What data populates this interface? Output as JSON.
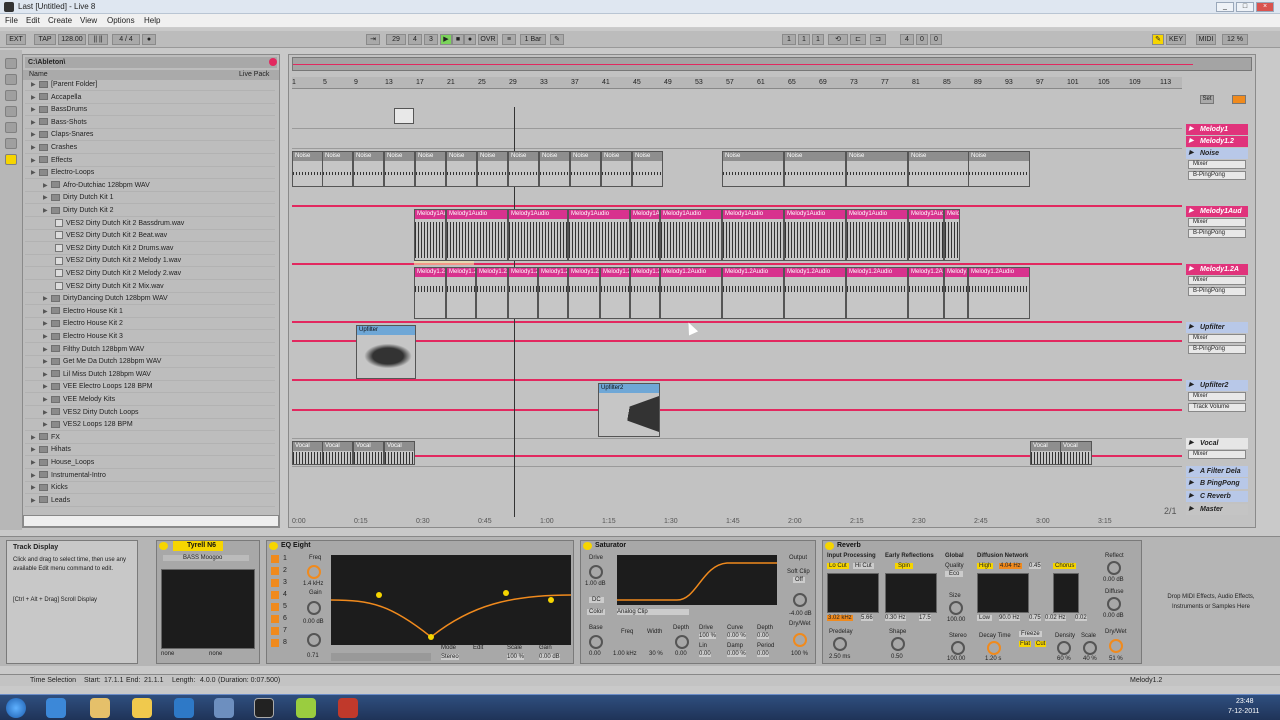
{
  "window": {
    "title": "Last  [Untitled] - Live 8",
    "controls": [
      "_",
      "□",
      "×"
    ]
  },
  "menu": [
    "File",
    "Edit",
    "Create",
    "View",
    "Options",
    "Help"
  ],
  "transport": {
    "ext": "EXT",
    "tap": "TAP",
    "tempo": "128.00",
    "meter": "4 / 4",
    "position": [
      "29",
      "4",
      "3"
    ],
    "ovr": "OVR",
    "quantize": "1 Bar",
    "loop_start": [
      "1",
      "1",
      "1"
    ],
    "loop_len": [
      "4",
      "0",
      "0"
    ],
    "key": "KEY",
    "midi": "MIDI",
    "cpu": "12 %"
  },
  "browser": {
    "path": "C:\\Ableton\\",
    "col_name": "Name",
    "col_live_pack": "Live Pack",
    "items": [
      {
        "label": "[Parent Folder]",
        "type": "folder",
        "indent": 0
      },
      {
        "label": "Accapella",
        "type": "folder",
        "indent": 0
      },
      {
        "label": "BassDrums",
        "type": "folder",
        "indent": 0
      },
      {
        "label": "Bass-Shots",
        "type": "folder",
        "indent": 0
      },
      {
        "label": "Claps-Snares",
        "type": "folder",
        "indent": 0
      },
      {
        "label": "Crashes",
        "type": "folder",
        "indent": 0
      },
      {
        "label": "Effects",
        "type": "folder",
        "indent": 0
      },
      {
        "label": "Electro-Loops",
        "type": "folder",
        "indent": 0
      },
      {
        "label": "Afro-Dutchiac 128bpm WAV",
        "type": "folder",
        "indent": 1
      },
      {
        "label": "Dirty Dutch Kit 1",
        "type": "folder",
        "indent": 1
      },
      {
        "label": "Dirty Dutch Kit 2",
        "type": "folder",
        "indent": 1
      },
      {
        "label": "VES2 Dirty Dutch Kit 2 Bassdrum.wav",
        "type": "file",
        "indent": 2
      },
      {
        "label": "VES2 Dirty Dutch Kit 2 Beat.wav",
        "type": "file",
        "indent": 2
      },
      {
        "label": "VES2 Dirty Dutch Kit 2 Drums.wav",
        "type": "file",
        "indent": 2
      },
      {
        "label": "VES2 Dirty Dutch Kit 2 Melody 1.wav",
        "type": "file",
        "indent": 2
      },
      {
        "label": "VES2 Dirty Dutch Kit 2 Melody 2.wav",
        "type": "file",
        "indent": 2
      },
      {
        "label": "VES2 Dirty Dutch Kit 2 Mix.wav",
        "type": "file",
        "indent": 2
      },
      {
        "label": "DirtyDancing Dutch 128bpm WAV",
        "type": "folder",
        "indent": 1
      },
      {
        "label": "Electro House Kit 1",
        "type": "folder",
        "indent": 1
      },
      {
        "label": "Electro House Kit 2",
        "type": "folder",
        "indent": 1
      },
      {
        "label": "Electro House Kit 3",
        "type": "folder",
        "indent": 1
      },
      {
        "label": "Filthy Dutch 128bpm WAV",
        "type": "folder",
        "indent": 1
      },
      {
        "label": "Get Me Da Dutch 128bpm WAV",
        "type": "folder",
        "indent": 1
      },
      {
        "label": "Lil Miss Dutch 128bpm WAV",
        "type": "folder",
        "indent": 1
      },
      {
        "label": "VEE Electro Loops 128 BPM",
        "type": "folder",
        "indent": 1
      },
      {
        "label": "VEE Melody Kits",
        "type": "folder",
        "indent": 1
      },
      {
        "label": "VES2 Dirty Dutch Loops",
        "type": "folder",
        "indent": 1
      },
      {
        "label": "VES2 Loops 128 BPM",
        "type": "folder",
        "indent": 1
      },
      {
        "label": "FX",
        "type": "folder",
        "indent": 0
      },
      {
        "label": "Hihats",
        "type": "folder",
        "indent": 0
      },
      {
        "label": "House_Loops",
        "type": "folder",
        "indent": 0
      },
      {
        "label": "Instrumental-Intro",
        "type": "folder",
        "indent": 0
      },
      {
        "label": "Kicks",
        "type": "folder",
        "indent": 0
      },
      {
        "label": "Leads",
        "type": "folder",
        "indent": 0
      }
    ]
  },
  "arrangement": {
    "ruler": [
      "1",
      "5",
      "9",
      "13",
      "17",
      "21",
      "25",
      "29",
      "33",
      "37",
      "41",
      "45",
      "49",
      "53",
      "57",
      "61",
      "65",
      "69",
      "73",
      "77",
      "81",
      "85",
      "89",
      "93",
      "97",
      "101",
      "105",
      "109",
      "113"
    ],
    "timeline": [
      "0:00",
      "0:15",
      "0:30",
      "0:45",
      "1:00",
      "1:15",
      "1:30",
      "1:45",
      "2:00",
      "2:15",
      "2:30",
      "2:45",
      "3:00",
      "3:15"
    ],
    "page": "2/1",
    "set_label": "Set"
  },
  "tracks": [
    {
      "name": "Melody1",
      "style": "pink",
      "mixer": null,
      "send": null
    },
    {
      "name": "Melody1.2",
      "style": "pink",
      "mixer": null,
      "send": null
    },
    {
      "name": "Noise",
      "style": "lav",
      "mixer": "Mixer",
      "send": "B-PingPong"
    },
    {
      "name": "Melody1Aud",
      "style": "pink",
      "mixer": "Mixer",
      "send": "B-PingPong"
    },
    {
      "name": "Melody1.2A",
      "style": "pink",
      "mixer": "Mixer",
      "send": "B-PingPong"
    },
    {
      "name": "Upfilter",
      "style": "lav",
      "mixer": "Mixer",
      "send": "B-PingPong"
    },
    {
      "name": "Upfilter2",
      "style": "lav",
      "mixer": "Mixer",
      "send": "Track Volume"
    },
    {
      "name": "Vocal",
      "style": "sil",
      "mixer": "Mixer",
      "send": null
    },
    {
      "name": "A Filter Dela",
      "style": "lav",
      "mixer": null,
      "send": null
    },
    {
      "name": "B PingPong",
      "style": "lav",
      "mixer": null,
      "send": null
    },
    {
      "name": "C Reverb",
      "style": "lav",
      "mixer": null,
      "send": null
    },
    {
      "name": "Master",
      "style": "grey",
      "mixer": null,
      "send": null
    }
  ],
  "clips": {
    "noise": "Noise",
    "melody_audio": "Melody1Audio",
    "melody_audio2": "Melody1.2Audio",
    "upfilter": "Upfilter",
    "upfilter2": "Upfilter2",
    "vocal": "Vocal"
  },
  "info": {
    "title": "Track Display",
    "text": "Click and drag to select time, then use any available Edit menu command to edit.",
    "shortcut": "[Ctrl + Alt + Drag] Scroll Display"
  },
  "devices": {
    "instrument": {
      "name": "Tyrell N6",
      "preset": "BASS Moogoo",
      "none1": "none",
      "none2": "none"
    },
    "eq": {
      "name": "EQ Eight",
      "freq_label": "Freq",
      "freq": "1.4 kHz",
      "gain_label": "Gain",
      "gain": "0.00 dB",
      "q": "0.71",
      "mode_label": "Mode",
      "mode": "Stereo",
      "edit_label": "Edit",
      "scale_label": "Scale",
      "scale": "100 %",
      "gain2_label": "Gain",
      "gain2": "0.00 dB",
      "bands": [
        "1",
        "2",
        "3",
        "4",
        "5",
        "6",
        "7",
        "8"
      ]
    },
    "saturator": {
      "name": "Saturator",
      "drive_label": "Drive",
      "drive": "1.00 dB",
      "dc": "DC",
      "color": "Color",
      "curve": "Analog Clip",
      "output_label": "Output",
      "soft_clip": "Soft Clip",
      "soft_clip_state": "Off",
      "output": "-4.00 dB",
      "drywet_label": "Dry/Wet",
      "drywet": "100 %",
      "base_label": "Base",
      "base": "0.00",
      "freq_label": "Freq",
      "freq": "1.00 kHz",
      "width_label": "Width",
      "width": "30 %",
      "depth_label": "Depth",
      "depth": "0.00",
      "drive2_label": "Drive",
      "drive2": "100 %",
      "curve_label": "Curve",
      "curve_val": "0.00 %",
      "lin_label": "Lin",
      "lin": "0.00",
      "damp_label": "Damp",
      "damp": "0.00 %",
      "period_label": "Period",
      "period": "0.00"
    },
    "reverb": {
      "name": "Reverb",
      "input_label": "Input Processing",
      "lo_cut": "Lo Cut",
      "hi_cut": "Hi Cut",
      "early_label": "Early Reflections",
      "spin": "Spin",
      "global_label": "Global",
      "quality_label": "Quality",
      "quality": "Eco",
      "diffusion_label": "Diffusion Network",
      "high": "High",
      "high_val": "4.04 Hz",
      "high_q": "0.45",
      "chorus": "Chorus",
      "reflect_label": "Reflect",
      "reflect": "0.00 dB",
      "in_freq": "3.02 kHz",
      "in_width": "5.66",
      "er_amount": "0.30 Hz",
      "er_shape": "17.5",
      "size_label": "Size",
      "size": "100.00",
      "low": "Low",
      "low_val": "90.0 Hz",
      "low_q": "0.75",
      "low_rate": "0.02 Hz",
      "low_amt": "0.02",
      "diffuse_label": "Diffuse",
      "diffuse": "0.00 dB",
      "predelay_label": "Predelay",
      "predelay": "2.50 ms",
      "shape_label": "Shape",
      "shape": "0.50",
      "stereo_label": "Stereo",
      "stereo": "100.00",
      "decay_label": "Decay Time",
      "decay": "1.20 s",
      "freeze": "Freeze",
      "flat": "Flat",
      "cut": "Cut",
      "density_label": "Density",
      "density": "60 %",
      "scale_label": "Scale",
      "scale": "40 %",
      "drywet_label": "Dry/Wet",
      "drywet": "51 %"
    },
    "drop_hint": "Drop MIDI Effects, Audio Effects, Instruments or Samples Here"
  },
  "status": {
    "mode": "Time Selection",
    "start_label": "Start:",
    "start": "17.1.1",
    "end_label": "End:",
    "end": "21.1.1",
    "length_label": "Length:",
    "length": "4.0.0",
    "duration": "(Duration: 0:07.500)",
    "track": "Melody1.2"
  },
  "taskbar": {
    "time": "23:48",
    "date": "7-12-2011"
  },
  "colors": {
    "accent": "#e2285f",
    "clip_pink": "#d8328e",
    "yellow": "#f6d500",
    "orange": "#f08a1d"
  }
}
